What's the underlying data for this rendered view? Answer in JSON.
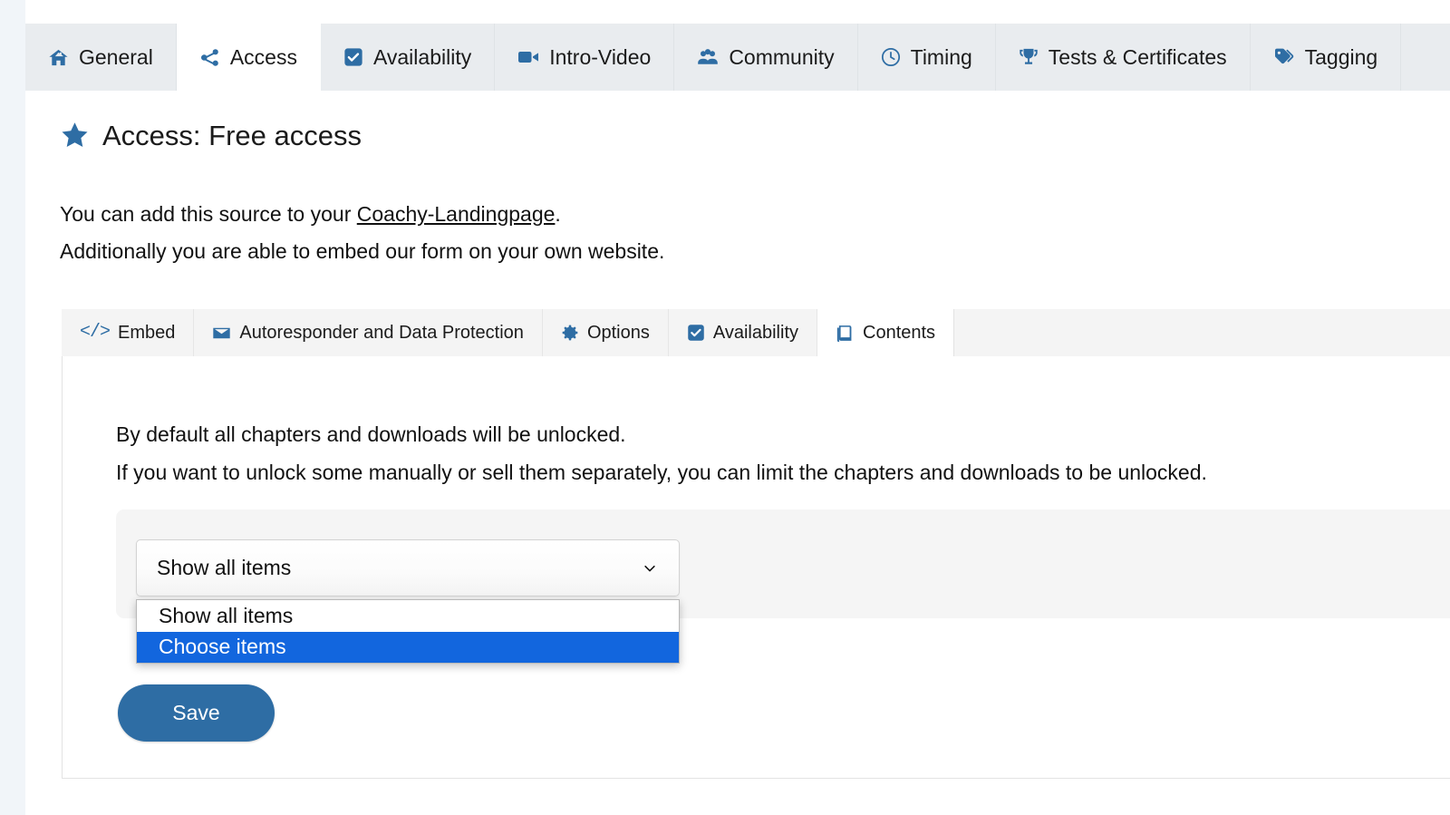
{
  "main_tabs": [
    {
      "label": "General",
      "icon": "home-icon",
      "active": false
    },
    {
      "label": "Access",
      "icon": "share-nodes-icon",
      "active": true
    },
    {
      "label": "Availability",
      "icon": "check-square-icon",
      "active": false
    },
    {
      "label": "Intro-Video",
      "icon": "video-camera-icon",
      "active": false
    },
    {
      "label": "Community",
      "icon": "users-icon",
      "active": false
    },
    {
      "label": "Timing",
      "icon": "clock-icon",
      "active": false
    },
    {
      "label": "Tests & Certificates",
      "icon": "trophy-icon",
      "active": false
    },
    {
      "label": "Tagging",
      "icon": "tags-icon",
      "active": false
    }
  ],
  "heading": {
    "icon": "star-icon",
    "text": "Access: Free access"
  },
  "intro": {
    "line1_before": "You can add this source to your ",
    "line1_link": "Coachy-Landingpage",
    "line1_after": ".",
    "line2": "Additionally you are able to embed our form on your own website."
  },
  "inner_tabs": [
    {
      "label": "Embed",
      "icon": "code-icon",
      "active": false
    },
    {
      "label": "Autoresponder and Data Protection",
      "icon": "envelope-icon",
      "active": false
    },
    {
      "label": "Options",
      "icon": "gear-icon",
      "active": false
    },
    {
      "label": "Availability",
      "icon": "check-square-icon",
      "active": false
    },
    {
      "label": "Contents",
      "icon": "book-icon",
      "active": true
    }
  ],
  "contents_panel": {
    "line1": "By default all chapters and downloads will be unlocked.",
    "line2": "If you want to unlock some manually or sell them separately, you can limit the chapters and downloads to be unlocked."
  },
  "item_select": {
    "value": "Show all items",
    "expanded": true,
    "options": [
      {
        "label": "Show all items",
        "highlighted": false
      },
      {
        "label": "Choose items",
        "highlighted": true
      }
    ]
  },
  "save_button": {
    "label": "Save"
  },
  "colors": {
    "page_background": "#f1f5f9",
    "accent": "#2e6da4",
    "tab_inactive": "#e9ecef",
    "inner_tab_inactive": "#f4f4f4",
    "field_band": "#f5f5f5",
    "dropdown_highlight": "#1266de",
    "text": "#111111"
  }
}
